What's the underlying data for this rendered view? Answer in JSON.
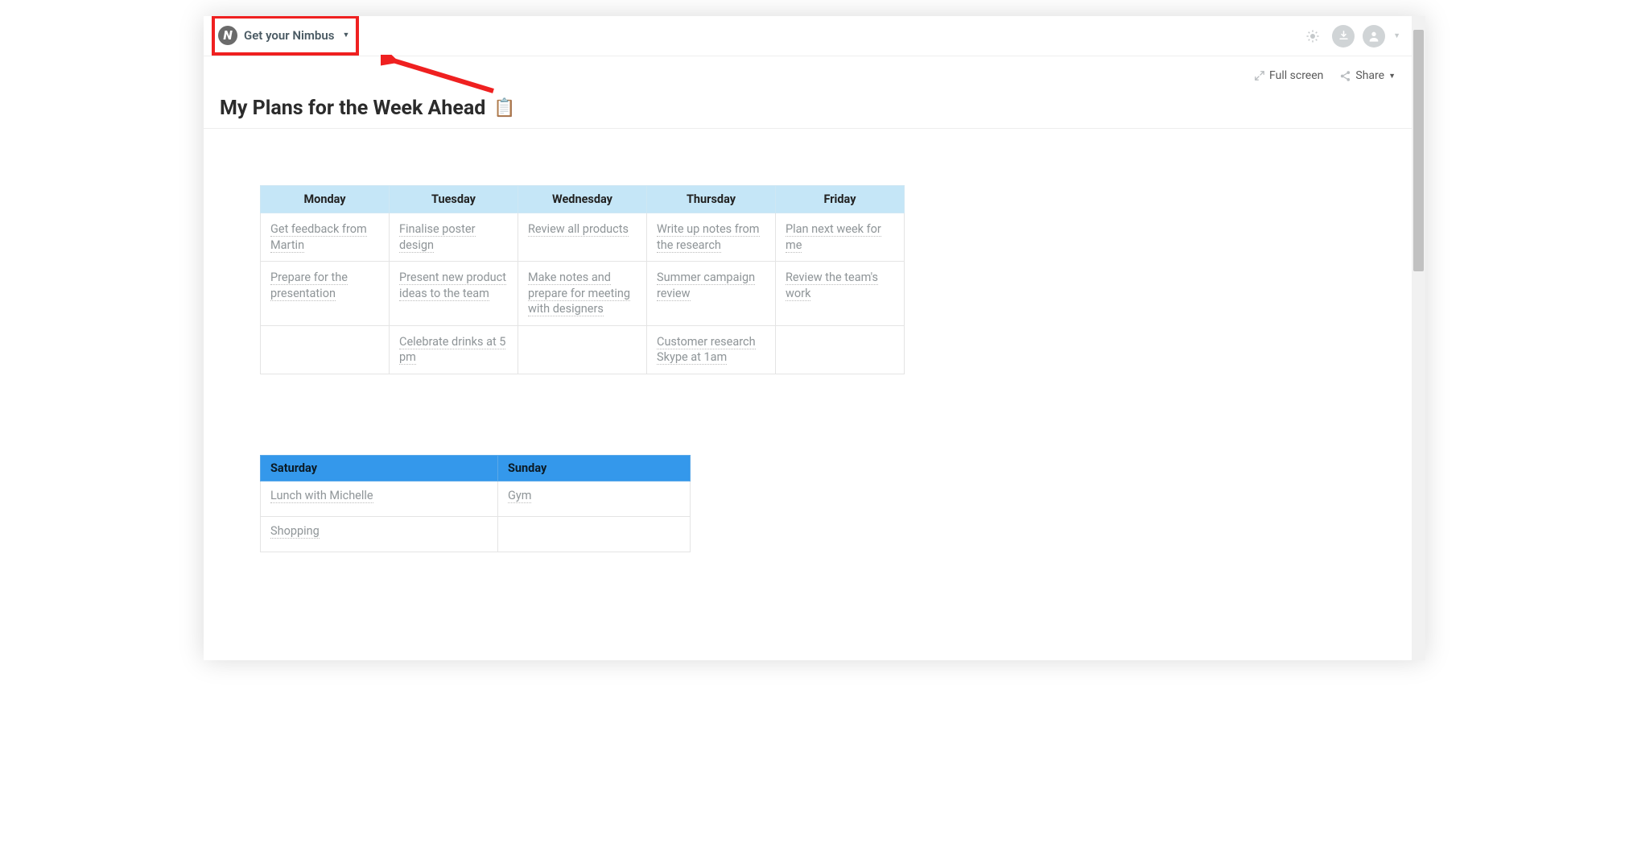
{
  "header": {
    "brand_label": "Get your Nimbus"
  },
  "actions": {
    "fullscreen": "Full screen",
    "share": "Share"
  },
  "page": {
    "title": "My Plans for the Week Ahead",
    "title_emoji": "📋"
  },
  "weekday_table": {
    "headers": [
      "Monday",
      "Tuesday",
      "Wednesday",
      "Thursday",
      "Friday"
    ],
    "rows": [
      [
        "Get feedback from Martin",
        "Finalise poster design",
        "Review all products",
        "Write up notes from the research",
        "Plan next week for me"
      ],
      [
        "Prepare for the presentation",
        "Present new product ideas to the team",
        "Make notes and prepare for meeting with designers",
        "Summer campaign review",
        "Review the team's work"
      ],
      [
        "",
        "Celebrate drinks at 5 pm",
        "",
        "Customer research Skype at 1am",
        ""
      ]
    ]
  },
  "weekend_table": {
    "headers": [
      "Saturday",
      "Sunday"
    ],
    "rows": [
      [
        "Lunch with Michelle",
        "Gym"
      ],
      [
        "Shopping",
        ""
      ]
    ]
  }
}
